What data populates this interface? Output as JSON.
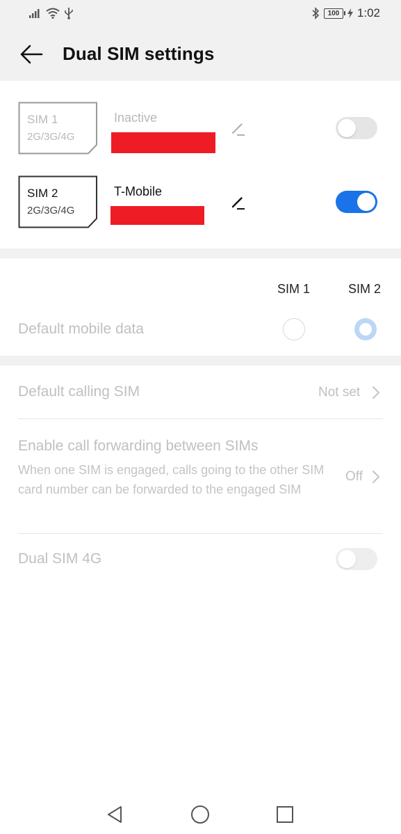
{
  "status_bar": {
    "battery": "100",
    "time": "1:02",
    "icons": [
      "signal-icon",
      "wifi-icon",
      "usb-icon",
      "bluetooth-icon",
      "battery-icon",
      "charging-icon"
    ]
  },
  "header": {
    "title": "Dual SIM settings"
  },
  "sims": [
    {
      "name": "SIM 1",
      "bands": "2G/3G/4G",
      "carrier": "Inactive",
      "enabled": false
    },
    {
      "name": "SIM 2",
      "bands": "2G/3G/4G",
      "carrier": "T-Mobile",
      "enabled": true
    }
  ],
  "mobile_data": {
    "col_sim1": "SIM 1",
    "col_sim2": "SIM 2",
    "label": "Default mobile data",
    "selected": "SIM 2"
  },
  "calling": {
    "label": "Default calling SIM",
    "value": "Not set"
  },
  "forwarding": {
    "label": "Enable call forwarding between SIMs",
    "description": "When one SIM is engaged, calls going to the other SIM card number can be forwarded to the engaged SIM",
    "value": "Off"
  },
  "dual4g": {
    "label": "Dual SIM 4G",
    "enabled": false
  },
  "colors": {
    "accent": "#1a73e8",
    "disabled_text": "#c0c0c0",
    "redaction": "#ee1c25",
    "band": "#f1f1f1"
  }
}
